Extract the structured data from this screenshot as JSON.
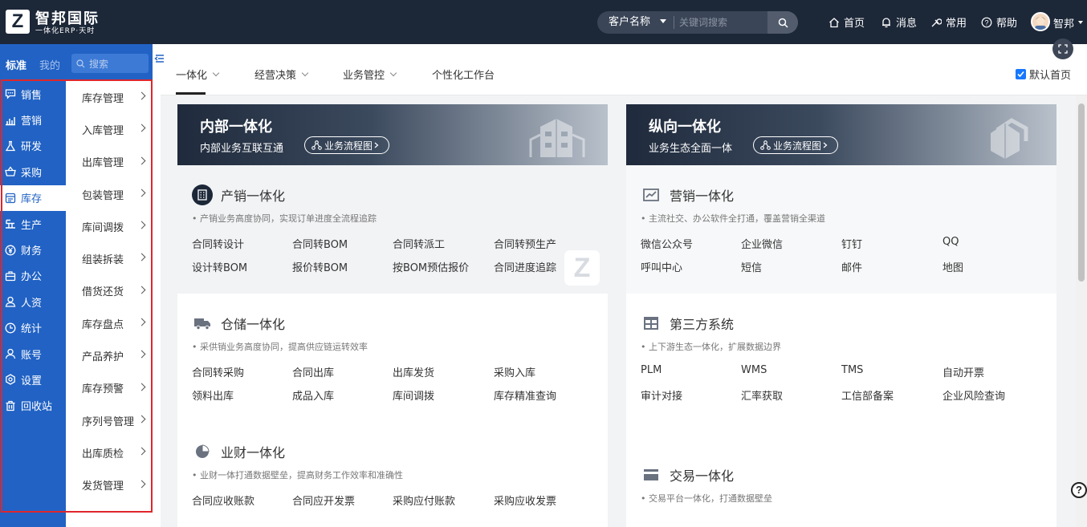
{
  "brand": {
    "logo_letter": "Z",
    "name": "智邦国际",
    "tagline": "一体化ERP·天时"
  },
  "search": {
    "type_label": "客户名称",
    "placeholder": "关键词搜索"
  },
  "top_nav": [
    {
      "label": "首页",
      "icon": "home-icon"
    },
    {
      "label": "消息",
      "icon": "bell-icon"
    },
    {
      "label": "常用",
      "icon": "wrench-icon"
    },
    {
      "label": "帮助",
      "icon": "help-icon"
    }
  ],
  "user": {
    "name": "智邦"
  },
  "left_rail": {
    "tabs": {
      "standard": "标准",
      "mine": "我的"
    },
    "search_placeholder": "搜索",
    "items": [
      {
        "label": "销售",
        "icon": "chat-icon"
      },
      {
        "label": "营销",
        "icon": "bar-chart-icon"
      },
      {
        "label": "研发",
        "icon": "flask-icon"
      },
      {
        "label": "采购",
        "icon": "basket-icon"
      },
      {
        "label": "库存",
        "icon": "inventory-icon"
      },
      {
        "label": "生产",
        "icon": "production-icon"
      },
      {
        "label": "财务",
        "icon": "yen-icon"
      },
      {
        "label": "办公",
        "icon": "briefcase-icon"
      },
      {
        "label": "人资",
        "icon": "person-icon"
      },
      {
        "label": "统计",
        "icon": "clock-icon"
      },
      {
        "label": "账号",
        "icon": "account-icon"
      },
      {
        "label": "设置",
        "icon": "settings-icon"
      },
      {
        "label": "回收站",
        "icon": "trash-icon"
      }
    ]
  },
  "sub_menu": [
    "库存管理",
    "入库管理",
    "出库管理",
    "包装管理",
    "库间调拨",
    "组装拆装",
    "借货还货",
    "库存盘点",
    "产品养护",
    "库存预警",
    "序列号管理",
    "出库质检",
    "发货管理"
  ],
  "tabs": [
    {
      "label": "一体化",
      "has_dropdown": true
    },
    {
      "label": "经营决策",
      "has_dropdown": true
    },
    {
      "label": "业务管控",
      "has_dropdown": true
    },
    {
      "label": "个性化工作台",
      "has_dropdown": false
    }
  ],
  "default_home": {
    "label": "默认首页",
    "checked": true
  },
  "columns": [
    {
      "title": "内部一体化",
      "subtitle": "内部业务互联互通",
      "pill": "业务流程图",
      "sections": [
        {
          "title": "产销一体化",
          "icon": "building-icon",
          "desc": "• 产销业务高度协同，实现订单进度全流程追踪",
          "links": [
            "合同转设计",
            "合同转BOM",
            "合同转派工",
            "合同转预生产",
            "设计转BOM",
            "报价转BOM",
            "按BOM预估报价",
            "合同进度追踪"
          ]
        },
        {
          "title": "仓储一体化",
          "icon": "truck-icon",
          "desc": "• 采供销业务高度协同，提高供应链运转效率",
          "links": [
            "合同转采购",
            "合同出库",
            "出库发货",
            "采购入库",
            "领料出库",
            "成品入库",
            "库间调拨",
            "库存精准查询"
          ]
        },
        {
          "title": "业财一体化",
          "icon": "pie-icon",
          "desc": "• 业财一体打通数据壁垒，提高财务工作效率和准确性",
          "links": [
            "合同应收账款",
            "合同应开发票",
            "采购应付账款",
            "采购应收发票"
          ]
        }
      ]
    },
    {
      "title": "纵向一体化",
      "subtitle": "业务生态全面一体",
      "pill": "业务流程图",
      "sections": [
        {
          "title": "营销一体化",
          "icon": "trend-icon",
          "desc": "• 主流社交、办公软件全打通，覆盖营销全渠道",
          "links": [
            "微信公众号",
            "企业微信",
            "钉钉",
            "QQ",
            "呼叫中心",
            "短信",
            "邮件",
            "地图"
          ]
        },
        {
          "title": "第三方系统",
          "icon": "window-icon",
          "desc": "• 上下游生态一体化，扩展数据边界",
          "links": [
            "PLM",
            "WMS",
            "TMS",
            "自动开票",
            "审计对接",
            "汇率获取",
            "工信部备案",
            "企业风险查询"
          ]
        },
        {
          "title": "交易一体化",
          "icon": "card-icon",
          "desc": "• 交易平台一体化，打通数据壁垒",
          "links": []
        }
      ]
    }
  ],
  "colors": {
    "topbar": "#1c2738",
    "rail": "#2162c4",
    "highlight_box": "#e0262b",
    "checkbox": "#1677ff"
  }
}
